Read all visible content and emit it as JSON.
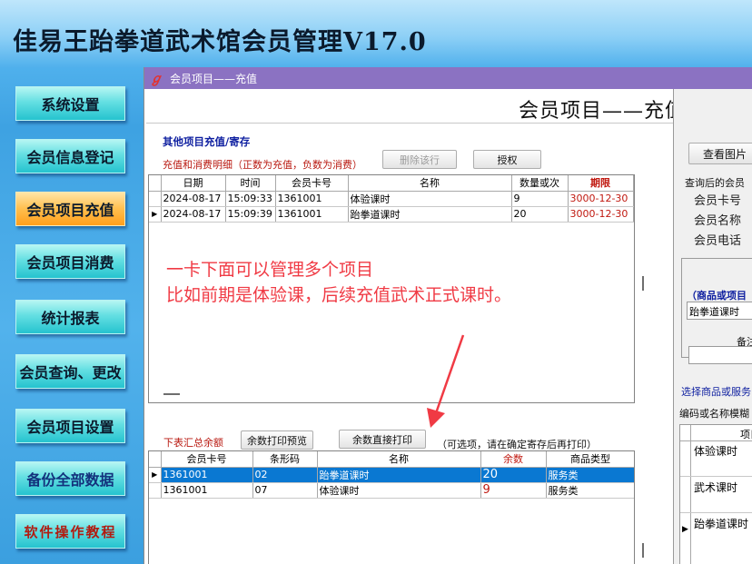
{
  "app_title": "佳易王跆拳道武术馆会员管理V17.0",
  "nav": [
    {
      "label": "系统设置",
      "style": "normal"
    },
    {
      "label": "会员信息登记",
      "style": "normal"
    },
    {
      "label": "会员项目充值",
      "style": "active"
    },
    {
      "label": "会员项目消费",
      "style": "normal"
    },
    {
      "label": "统计报表",
      "style": "normal"
    },
    {
      "label": "会员查询、更改",
      "style": "normal"
    },
    {
      "label": "会员项目设置",
      "style": "normal"
    },
    {
      "label": "备份全部数据",
      "style": "blue"
    },
    {
      "label": "软件操作教程",
      "style": "red"
    }
  ],
  "window": {
    "logo": "ℊ",
    "title": "会员项目——充值",
    "header": "会员项目——充值"
  },
  "upper": {
    "section_title": "其他项目充值/寄存",
    "detail_label": "充值和消费明细（正数为充值，负数为消费）",
    "delete_btn": "删除该行",
    "auth_btn": "授权",
    "columns": [
      "日期",
      "时间",
      "会员卡号",
      "名称",
      "数量或次",
      "期限"
    ],
    "rows": [
      {
        "date": "2024-08-17",
        "time": "15:09:33",
        "card": "1361001",
        "name": "体验课时",
        "qty": "9",
        "deadline": "3000-12-30",
        "current": false
      },
      {
        "date": "2024-08-17",
        "time": "15:09:39",
        "card": "1361001",
        "name": "跆拳道课时",
        "qty": "20",
        "deadline": "3000-12-30",
        "current": true
      }
    ]
  },
  "annotation": {
    "line1": "一卡下面可以管理多个项目",
    "line2": "比如前期是体验课，后续充值武术正式课时。"
  },
  "lower": {
    "summary_label": "下表汇总余额",
    "print_preview_btn": "余数打印预览",
    "direct_print_btn": "余数直接打印",
    "hint": "（可选项，请在确定寄存后再打印）",
    "columns": [
      "会员卡号",
      "条形码",
      "名称",
      "余数",
      "商品类型"
    ],
    "rows": [
      {
        "card": "1361001",
        "code": "02",
        "name": "跆拳道课时",
        "balance": "20",
        "type": "服务类",
        "selected": true
      },
      {
        "card": "1361001",
        "code": "07",
        "name": "体验课时",
        "balance": "9",
        "type": "服务类",
        "selected": false
      }
    ]
  },
  "right_panel": {
    "view_image_btn": "查看图片",
    "query_label": "查询后的会员",
    "fields": [
      "会员卡号",
      "会员名称",
      "会员电话"
    ],
    "product_title": "（商品或项目",
    "product_value": "跆拳道课时",
    "remark_label": "备注",
    "select_label": "选择商品或服务",
    "search_label": "编码或名称模糊",
    "list_header": "项目",
    "list_items": [
      "体验课时",
      "武术课时",
      "跆拳道课时"
    ]
  },
  "colors": {
    "accent": "#8b72c2",
    "selection": "#0a78d2",
    "deadline_red": "#c0180f",
    "annotation": "#f03a44"
  }
}
